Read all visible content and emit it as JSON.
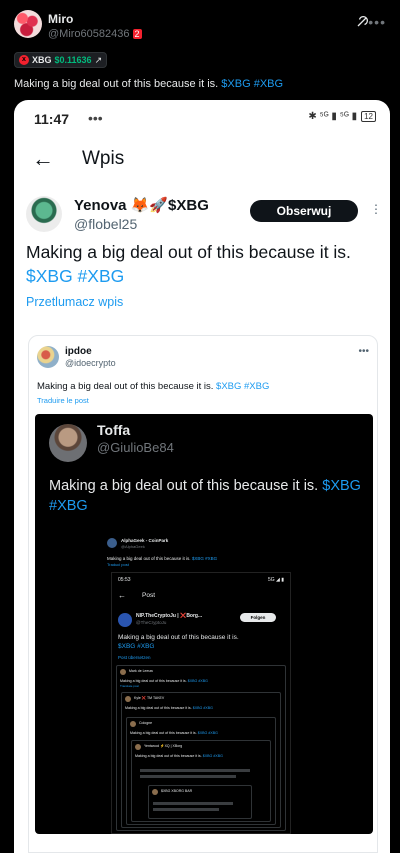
{
  "outer": {
    "name": "Miro",
    "handle": "@Miro60582436",
    "handle_badge": "2",
    "ticker": {
      "icon": "x",
      "symbol": "XBG",
      "price": "$0.11636",
      "arrow": "↗"
    },
    "text": "Making a big deal out of this because it is.",
    "hashtags": "$XBG #XBG"
  },
  "phone": {
    "time": "11:47",
    "dots": "•••",
    "status_right": "✱ ⁵ᴳ ▮ ⁵ᴳ ▮",
    "battery": "12",
    "header_title": "Wpis",
    "author": {
      "name": "Yenova 🦊🚀$XBG",
      "handle": "@flobel25",
      "follow_label": "Obserwuj"
    },
    "text": "Making a big deal out of this because it is.",
    "hashtags": "$XBG #XBG",
    "translate_label": "Przetlumacz wpis"
  },
  "quote": {
    "name": "ipdoe",
    "handle": "@idoecrypto",
    "text": "Making a big deal out of this because it is.",
    "hashtags": "$XBG #XBG",
    "translate_label": "Traduire le post"
  },
  "dark": {
    "name": "Toffa",
    "handle": "@GiulioBe84",
    "text": "Making a big deal out of this because it is.",
    "hashtags_1": "$XBG",
    "hashtags_2": "#XBG"
  },
  "level2": {
    "name": "AlphaGeek - CoinPark",
    "handle": "@AlphaGeek",
    "text": "Making a big deal out of this because it is.",
    "hashtags": "$XBG #XBG",
    "translate_label": "Traduci post"
  },
  "level3": {
    "time": "05:53",
    "status_right": "5G ◢ ▮",
    "header_title": "Post",
    "name": "NIP.TheCryptoJu | ❌Borg...",
    "handle": "@TheCryptoJu",
    "follow_label": "Folgen",
    "text": "Making a big deal out of this because it is.",
    "hashtags": "$XBG #XBG",
    "translate_label": "Post übersetzen"
  },
  "level4": {
    "name": "Mark de Leeuw",
    "handle": "@Mark_de_Leeuw",
    "text": "Making a big deal out of this because it is.",
    "hashtags": "$XBG #XBG",
    "translate_label": "Translate post"
  },
  "level5": {
    "name": "Kyle ❌ TM TAKEV",
    "text": "Making a big deal out of this because it is.",
    "hashtags": "$XBG #XBG"
  },
  "level6": {
    "name": "Cologne",
    "text": "Making a big deal out of this because it is.",
    "hashtags": "$XBG #XBG"
  },
  "level7": {
    "name": "Yentwood ⚡XQ | XBorg",
    "text": "Making a big deal out of this because it is.",
    "hashtags": "$XBG #XBG"
  },
  "level8": {
    "name": "$XBG XBORG BAR"
  }
}
